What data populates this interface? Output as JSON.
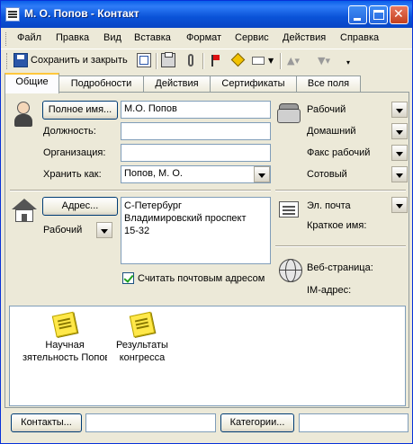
{
  "window": {
    "title": "М. О. Попов - Контакт"
  },
  "menu": [
    "Файл",
    "Правка",
    "Вид",
    "Вставка",
    "Формат",
    "Сервис",
    "Действия",
    "Справка"
  ],
  "toolbar": {
    "save_close_label": "Сохранить и закрыть"
  },
  "tabs": [
    "Общие",
    "Подробности",
    "Действия",
    "Сертификаты",
    "Все поля"
  ],
  "general": {
    "full_name_button": "Полное имя...",
    "full_name_value": "М.О. Попов",
    "job_title_label": "Должность:",
    "job_title_value": "",
    "company_label": "Организация:",
    "company_value": "",
    "file_as_label": "Хранить как:",
    "file_as_value": "Попов, М. О.",
    "phones": [
      "Рабочий",
      "Домашний",
      "Факс рабочий",
      "Сотовый"
    ],
    "address_button": "Адрес...",
    "address_type": "Рабочий",
    "address_lines": [
      "С-Петербург",
      "Владимировский проспект",
      "15-32"
    ],
    "mailing_checkbox_label": "Считать почтовым адресом",
    "mailing_checked": true,
    "email_label": "Эл. почта",
    "display_as_label": "Краткое имя:",
    "webpage_label": "Веб-страница:",
    "im_label": "IM-адрес:"
  },
  "attachments": [
    {
      "line1": "Научная",
      "line2": "зятельность Попов"
    },
    {
      "line1": "Результаты",
      "line2": "конгресса"
    }
  ],
  "bottom": {
    "contacts_button": "Контакты...",
    "contacts_value": "",
    "categories_button": "Категории...",
    "categories_value": ""
  },
  "colors": {
    "title_bar": "#0a5ee8",
    "active_tab_accent": "#ffc73c",
    "face": "#ece9d8"
  }
}
